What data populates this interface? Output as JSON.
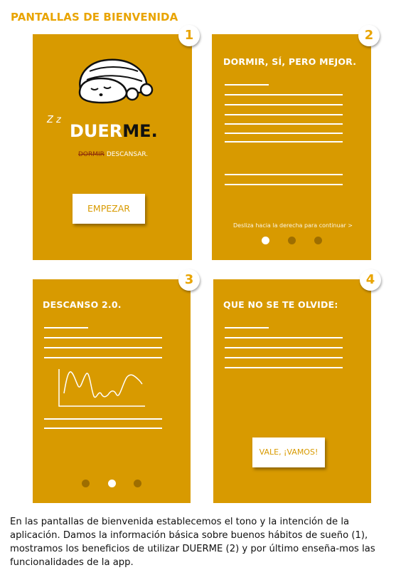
{
  "title": "PANTALLAS DE BIENVENIDA",
  "screens": [
    {
      "number": "1",
      "logo_light": "DUER",
      "logo_dark": "ME.",
      "zz": "Z z",
      "subtitle_strike": "DORMIR",
      "subtitle_rest": " DESCANSAR.",
      "button": "EMPEZAR"
    },
    {
      "number": "2",
      "heading": "DORMIR, SÍ, PERO MEJOR.",
      "swipe_hint": "Desliza hacia la derecha para continuar >"
    },
    {
      "number": "3",
      "heading": "DESCANSO 2.0."
    },
    {
      "number": "4",
      "heading": "QUE NO SE TE OLVIDE:",
      "button": "VALE, ¡VAMOS!"
    }
  ],
  "colors": {
    "card": "#D89A00",
    "accent": "#E9A400"
  },
  "caption": "En las pantallas de bienvenida establecemos el tono y la intención de la aplicación. Damos la información básica sobre buenos hábitos de sueño (1), mostramos los beneficios de utilizar DUERME (2) y por último enseña-mos las funcionalidades de la app."
}
